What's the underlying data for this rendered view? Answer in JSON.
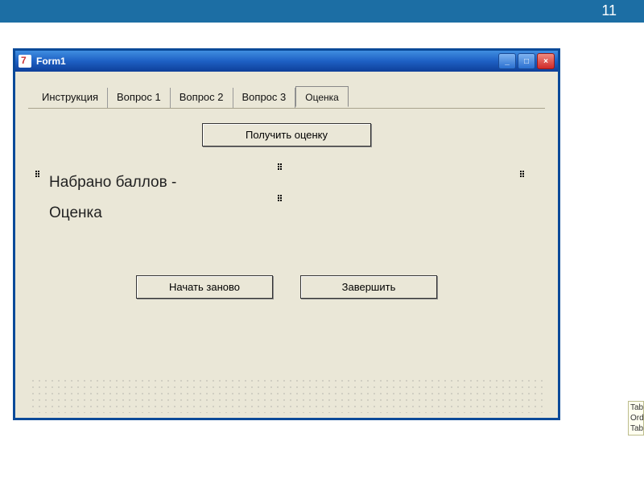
{
  "slide": {
    "number": "11"
  },
  "window": {
    "title": "Form1",
    "controls": {
      "min": "_",
      "max": "□",
      "close": "×"
    }
  },
  "tabs": {
    "items": [
      {
        "label": "Инструкция",
        "active": false
      },
      {
        "label": "Вопрос 1",
        "active": false
      },
      {
        "label": "Вопрос 2",
        "active": false
      },
      {
        "label": "Вопрос 3",
        "active": false
      },
      {
        "label": "Оценка",
        "active": true
      }
    ]
  },
  "panel": {
    "get_score_button": "Получить оценку",
    "score_label": "Набрано баллов  -",
    "grade_label": "Оценка",
    "restart_button": "Начать заново",
    "finish_button": "Завершить"
  },
  "props_peek": {
    "line1": "Tab",
    "line2": "Ord",
    "line3": "Tab"
  }
}
